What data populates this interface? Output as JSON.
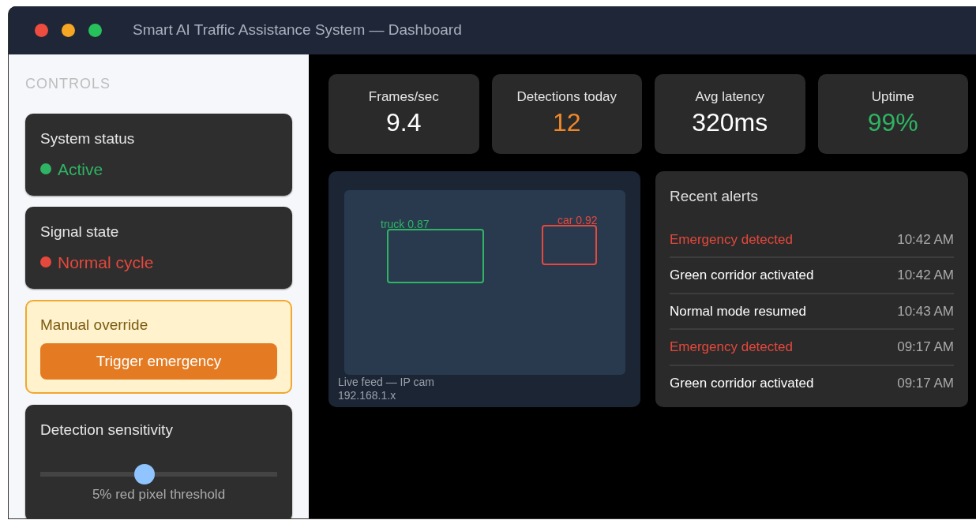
{
  "window": {
    "title": "Smart AI Traffic Assistance System — Dashboard"
  },
  "sidebar": {
    "heading": "CONTROLS",
    "status_cards": [
      {
        "label": "System status",
        "value": "Active",
        "color": "#2fb463"
      },
      {
        "label": "Signal state",
        "value": "Normal cycle",
        "color": "#e5483c"
      }
    ],
    "override": {
      "label": "Manual override",
      "button": "Trigger emergency"
    },
    "sensitivity": {
      "label": "Detection sensitivity",
      "level": 0.44,
      "reading": "5% red pixel threshold"
    }
  },
  "stats": [
    {
      "label": "Frames/sec",
      "value": "9.4",
      "color": "#ffffff"
    },
    {
      "label": "Detections today",
      "value": "12",
      "color": "#f0882a"
    },
    {
      "label": "Avg latency",
      "value": "320ms",
      "color": "#ffffff"
    },
    {
      "label": "Uptime",
      "value": "99%",
      "color": "#2fb463"
    }
  ],
  "feed": {
    "detections": [
      {
        "label": "truck 0.87",
        "color": "#2fb463"
      },
      {
        "label": "car 0.92",
        "color": "#e5483c"
      }
    ],
    "caption": [
      "Live feed — IP cam",
      "192.168.1.x"
    ]
  },
  "alerts": {
    "title": "Recent alerts",
    "items": [
      {
        "text": "Emergency detected",
        "time": "10:42 AM",
        "color": "#e5483c"
      },
      {
        "text": "Green corridor activated",
        "time": "10:42 AM",
        "color": "#ffffff"
      },
      {
        "text": "Normal mode resumed",
        "time": "10:43 AM",
        "color": "#ffffff"
      },
      {
        "text": "Emergency detected",
        "time": "09:17 AM",
        "color": "#e5483c"
      },
      {
        "text": "Green corridor activated",
        "time": "09:17 AM",
        "color": "#ffffff"
      }
    ]
  }
}
